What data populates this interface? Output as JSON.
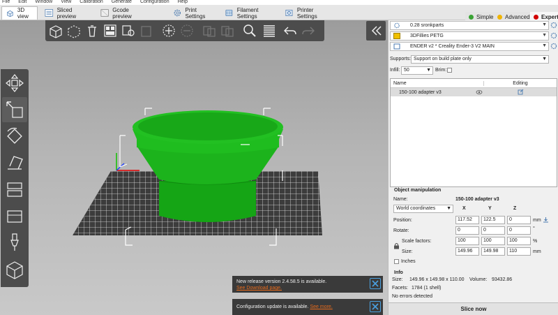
{
  "menubar": [
    "File",
    "Edit",
    "Window",
    "View",
    "Calibration",
    "Generate",
    "Configuration",
    "Help"
  ],
  "tabs": [
    {
      "label": "3D view",
      "icon": "cube-3d-icon"
    },
    {
      "label": "Sliced preview",
      "icon": "sliced-preview-icon"
    },
    {
      "label": "Gcode preview",
      "icon": "gcode-preview-icon"
    },
    {
      "label": "Print Settings",
      "icon": "print-settings-gear-icon"
    },
    {
      "label": "Filament Settings",
      "icon": "filament-settings-icon"
    },
    {
      "label": "Printer Settings",
      "icon": "printer-settings-icon"
    }
  ],
  "modes": [
    {
      "label": "Simple",
      "color": "#3aa335"
    },
    {
      "label": "Advanced",
      "color": "#f0b400"
    },
    {
      "label": "Expert",
      "color": "#d10000"
    }
  ],
  "viewport": {
    "model_color": "#19a319",
    "notifications": [
      {
        "text": "New release version 2.4.58.5 is available.",
        "link": "See Download page."
      },
      {
        "text": "Configuration update is available.",
        "link": "See more."
      }
    ]
  },
  "sidebar": {
    "print_preset": "0.28 sronkparts",
    "filament_preset": "3DFillies PETG",
    "printer_preset": "ENDER v2 * Creality Ender-3 V2 MAIN",
    "supports_label": "Supports:",
    "supports_value": "Support on build plate only",
    "infill_label": "Infill:",
    "infill_value": "50",
    "brim_label": "Brim:",
    "object_list": {
      "col_name": "Name",
      "col_editing": "Editing",
      "rows": [
        {
          "name": "150-100 adapter v3"
        }
      ]
    },
    "manip": {
      "title": "Object manipulation",
      "name_label": "Name:",
      "name_value": "150-100 adapter v3",
      "coords": "World coordinates",
      "axis_x": "X",
      "axis_y": "Y",
      "axis_z": "Z",
      "position_label": "Position:",
      "position": [
        "117.52",
        "122.5",
        "0"
      ],
      "position_unit": "mm",
      "rotate_label": "Rotate:",
      "rotate": [
        "0",
        "0",
        "0"
      ],
      "rotate_unit": "°",
      "scale_label": "Scale factors:",
      "scale": [
        "100",
        "100",
        "100"
      ],
      "scale_unit": "%",
      "size_label": "Size:",
      "size": [
        "149.96",
        "149.98",
        "110"
      ],
      "size_unit": "mm",
      "inches_label": "Inches"
    },
    "info": {
      "title": "Info",
      "size_label": "Size:",
      "size_value": "149.96 x 149.98 x 110.00",
      "volume_label": "Volume:",
      "volume_value": "93432.86",
      "facets_label": "Facets:",
      "facets_value": "1784 (1 shell)",
      "errors": "No errors detected"
    },
    "slice_button": "Slice now"
  }
}
